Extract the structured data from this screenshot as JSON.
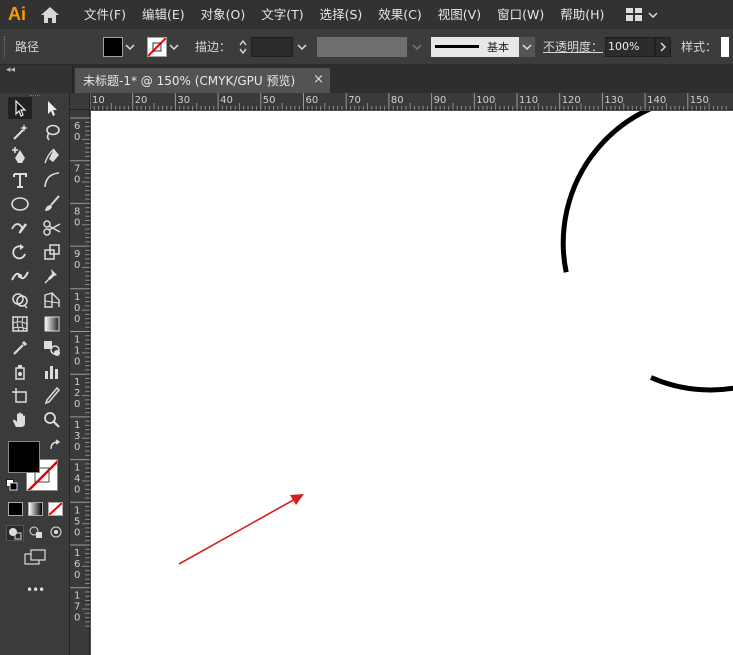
{
  "app": {
    "logo": "Ai"
  },
  "menu": [
    "文件(F)",
    "编辑(E)",
    "对象(O)",
    "文字(T)",
    "选择(S)",
    "效果(C)",
    "视图(V)",
    "窗口(W)",
    "帮助(H)"
  ],
  "control_bar": {
    "selection_label": "路径",
    "stroke_label": "描边：",
    "stroke_style": "基本",
    "opacity_label": "不透明度：",
    "opacity_value": "100%",
    "style_label": "样式："
  },
  "document_tab": {
    "title": "未标题-1* @ 150% (CMYK/GPU 预览)",
    "close": "×"
  },
  "rulers": {
    "horizontal": [
      "10",
      "20",
      "30",
      "40",
      "50",
      "60",
      "70",
      "80",
      "90",
      "100",
      "110",
      "120",
      "130",
      "140",
      "150"
    ],
    "vertical": [
      "60",
      "70",
      "80",
      "90",
      "100",
      "110",
      "120",
      "130",
      "140",
      "150",
      "160",
      "170"
    ]
  },
  "toolbar": {
    "tools": [
      "selection-tool",
      "direct-selection-tool",
      "magic-wand-tool",
      "lasso-tool",
      "pen-tool",
      "curvature-tool",
      "type-tool",
      "line-segment-tool",
      "ellipse-tool",
      "paintbrush-tool",
      "shaper-tool",
      "scissors-tool",
      "rotate-tool",
      "scale-tool",
      "width-tool",
      "puppet-warp-tool",
      "shape-builder-tool",
      "perspective-grid-tool",
      "mesh-tool",
      "gradient-tool",
      "eyedropper-tool",
      "blend-tool",
      "symbol-sprayer-tool",
      "column-graph-tool",
      "artboard-tool",
      "slice-tool",
      "hand-tool",
      "zoom-tool"
    ],
    "more": "•••"
  },
  "colors": {
    "fill": "#000000",
    "stroke_none": "#ff0000",
    "app_accent": "#ff9a00",
    "arrow": "#d22020"
  }
}
